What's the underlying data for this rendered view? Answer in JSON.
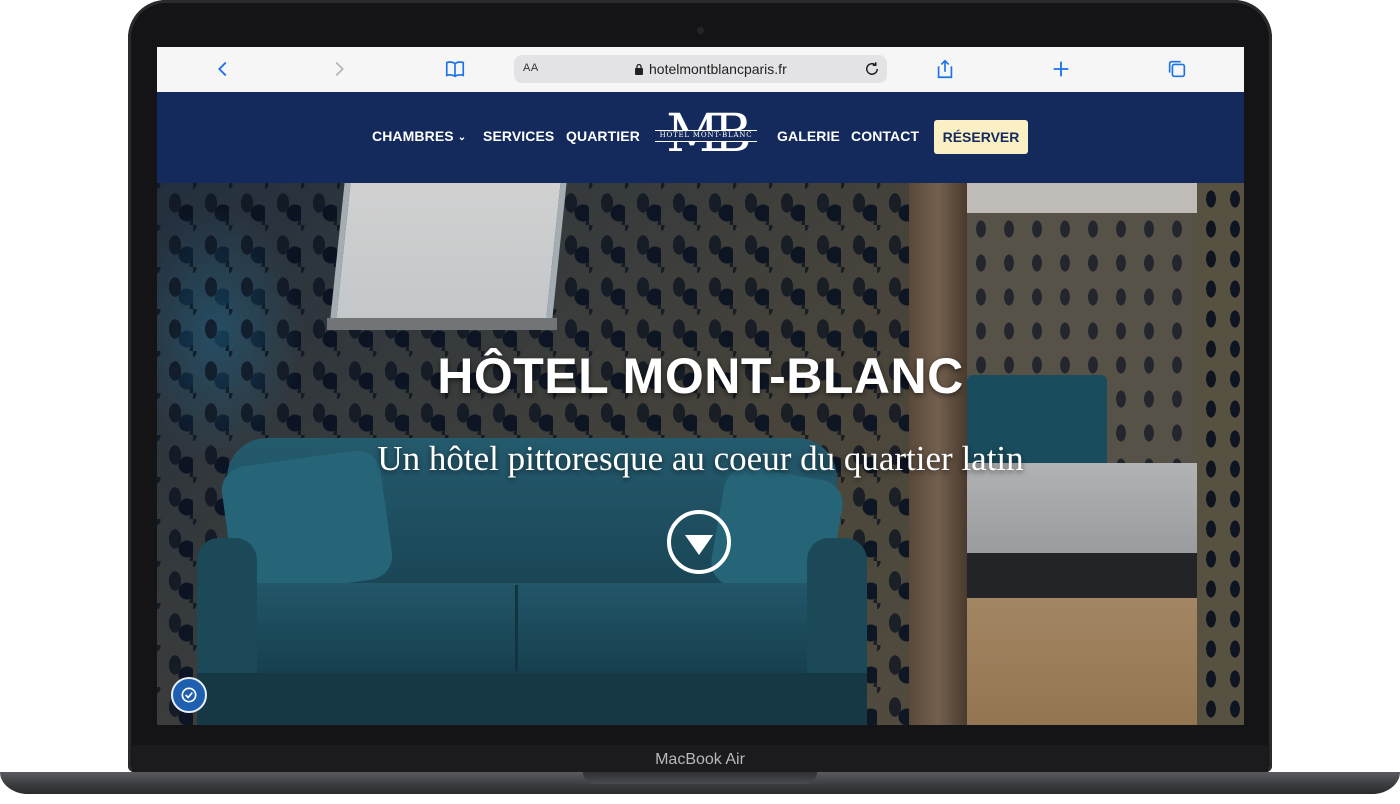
{
  "device": {
    "model_label": "MacBook Air"
  },
  "browser": {
    "text_size_label": "AA",
    "url": "hotelmontblancparis.fr"
  },
  "nav": {
    "items": [
      {
        "label": "CHAMBRES",
        "has_dropdown": true
      },
      {
        "label": "SERVICES"
      },
      {
        "label": "QUARTIER"
      },
      {
        "label": "GALERIE"
      },
      {
        "label": "CONTACT"
      }
    ],
    "logo": {
      "letters": "MB",
      "subtitle": "HOTEL MONT-BLANC"
    },
    "reserve_label": "RÉSERVER"
  },
  "hero": {
    "title": "HÔTEL MONT-BLANC",
    "subtitle": "Un hôtel pittoresque au coeur du quartier latin",
    "scroll_icon": "down-arrow-circle-icon",
    "accessibility_icon": "accessibility-icon"
  },
  "colors": {
    "nav_bg": "#152a5c",
    "reserve_bg": "#fbefc4",
    "browser_accent": "#1a73e8"
  }
}
